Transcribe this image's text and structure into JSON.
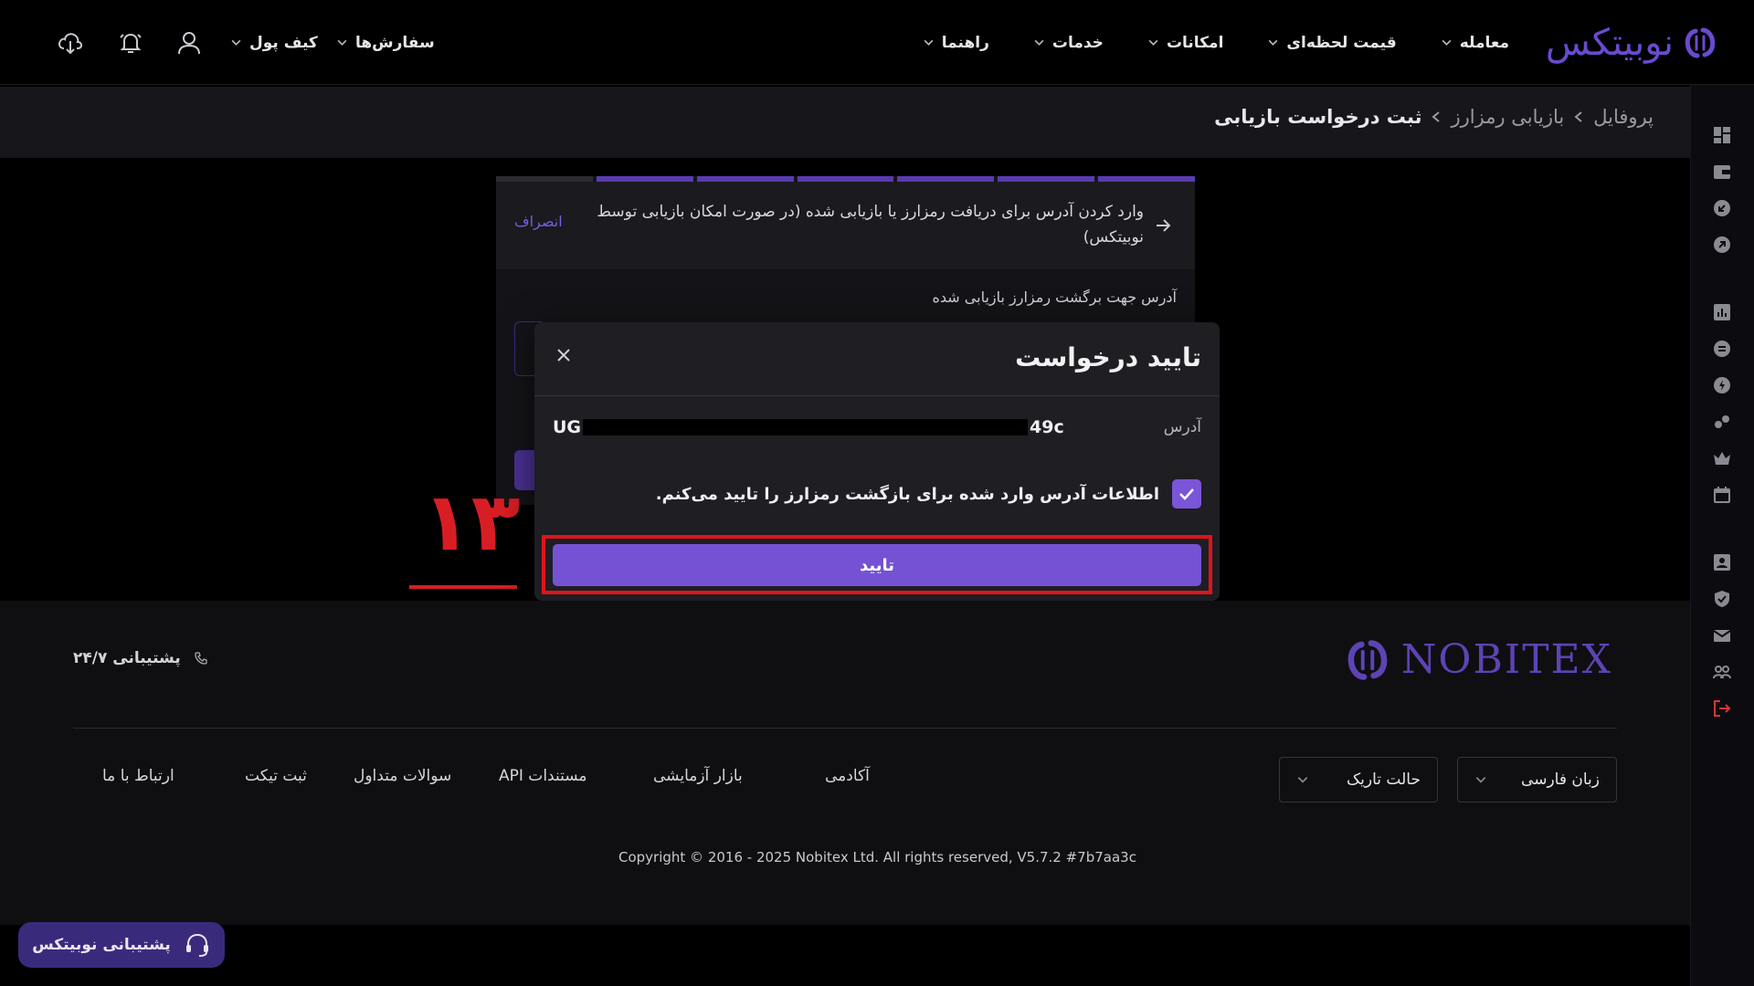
{
  "header": {
    "logo_text": "نوبیتکس",
    "nav": [
      {
        "label": "معامله"
      },
      {
        "label": "قیمت لحظه‌ای"
      },
      {
        "label": "امکانات"
      },
      {
        "label": "خدمات"
      },
      {
        "label": "راهنما"
      }
    ],
    "orders_label": "سفارش‌ها",
    "wallet_label": "کیف پول"
  },
  "breadcrumb": {
    "items": [
      "پروفایل",
      "بازیابی رمزارز",
      "ثبت درخواست بازیابی"
    ]
  },
  "card": {
    "title": "وارد کردن آدرس برای دریافت رمزارز یا بازیابی شده (در صورت امکان بازیابی توسط نوبیتکس)",
    "cancel": "انصراف",
    "field_label": "آدرس جهت برگشت رمزارز بازیابی شده"
  },
  "annotation": {
    "number": "۱۳"
  },
  "modal": {
    "title": "تایید درخواست",
    "address_label": "آدرس",
    "address_prefix": "UG",
    "address_suffix": "49c",
    "confirm_text": "اطلاعات آدرس وارد شده برای بازگشت رمزارز را تایید می‌کنم.",
    "confirm_checked": true,
    "confirm_button": "تایید"
  },
  "footer": {
    "logo_text": "NOBITEX",
    "support_text": "پشتیبانی ۲۴/۷",
    "language": "زبان فارسی",
    "theme": "حالت تاریک",
    "links": [
      "آکادمی",
      "بازار آزمایشی",
      "مستندات API",
      "سوالات متداول",
      "ثبت تیکت",
      "ارتباط با ما"
    ],
    "copyright": "Copyright © 2016 - 2025 Nobitex Ltd. All rights reserved, V5.7.2 #7b7aa3c"
  },
  "floating_support": "پشتیبانی نوبیتکس",
  "colors": {
    "accent": "#7452d3",
    "highlight": "#e0131b",
    "background": "#000000",
    "panel": "#1e1e23"
  },
  "sidebar_icons": [
    "dashboard-icon",
    "wallet-icon",
    "deposit-icon",
    "withdraw-icon",
    "chart-icon",
    "exchange-icon",
    "lightning-icon",
    "gift-icon",
    "crown-icon",
    "calendar-icon",
    "profile-icon",
    "security-icon",
    "mail-icon",
    "referral-icon",
    "logout-icon"
  ]
}
